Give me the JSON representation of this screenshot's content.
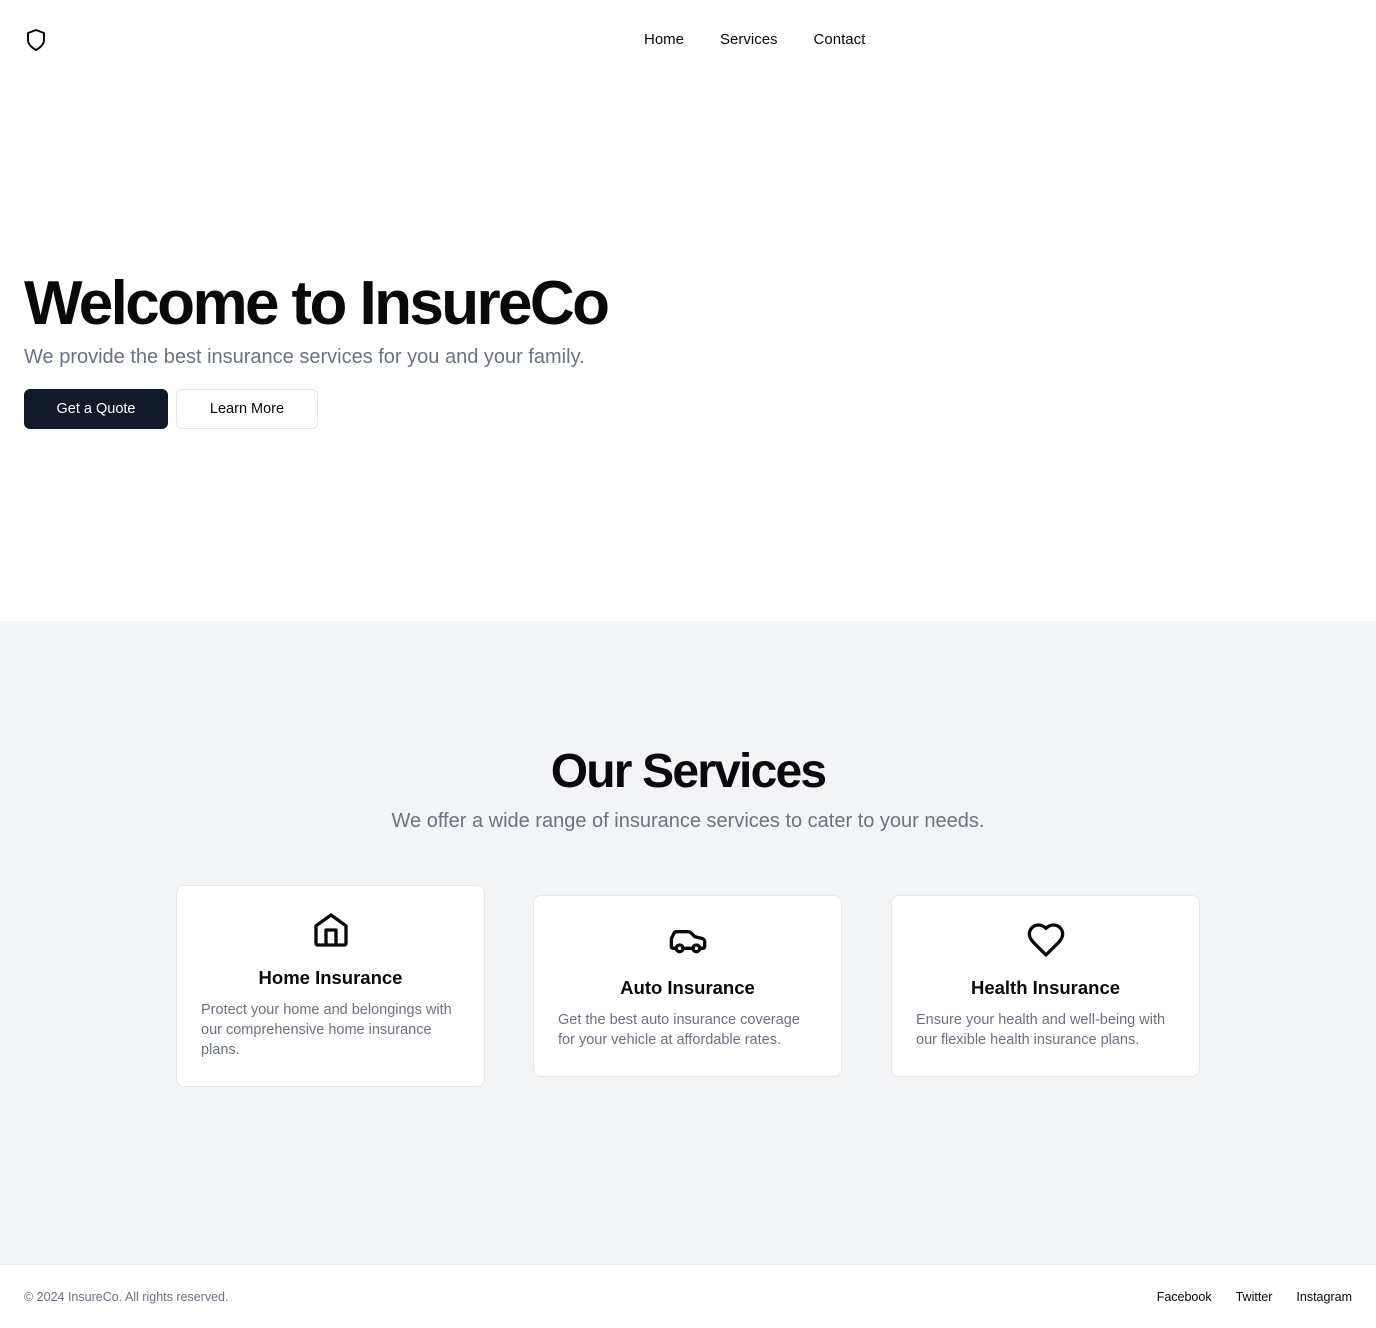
{
  "header": {
    "logo_icon": "shield-icon",
    "nav": [
      {
        "label": "Home"
      },
      {
        "label": "Services"
      },
      {
        "label": "Contact"
      }
    ]
  },
  "hero": {
    "title": "Welcome to InsureCo",
    "subtitle": "We provide the best insurance services for you and your family.",
    "primary_button": "Get a Quote",
    "secondary_button": "Learn More"
  },
  "services": {
    "title": "Our Services",
    "subtitle": "We offer a wide range of insurance services to cater to your needs.",
    "cards": [
      {
        "icon": "home-icon",
        "title": "Home Insurance",
        "description": "Protect your home and belongings with our comprehensive home insurance plans."
      },
      {
        "icon": "car-icon",
        "title": "Auto Insurance",
        "description": "Get the best auto insurance coverage for your vehicle at affordable rates."
      },
      {
        "icon": "heart-icon",
        "title": "Health Insurance",
        "description": "Ensure your health and well-being with our flexible health insurance plans."
      }
    ]
  },
  "footer": {
    "copyright": "© 2024 InsureCo. All rights reserved.",
    "links": [
      {
        "label": "Facebook"
      },
      {
        "label": "Twitter"
      },
      {
        "label": "Instagram"
      }
    ]
  },
  "colors": {
    "primary": "#111827",
    "muted_text": "#6b7280",
    "section_bg": "#f3f4f6",
    "border": "#e5e7eb"
  }
}
